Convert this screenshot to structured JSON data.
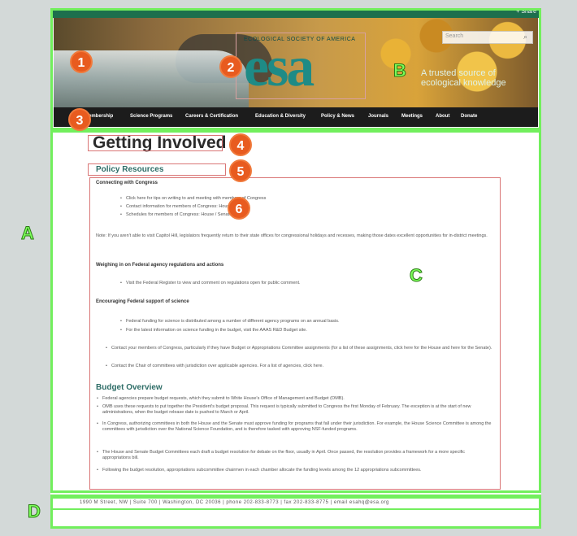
{
  "header": {
    "share_label": "+ Share",
    "search_placeholder": "Search",
    "logo_top_text": "ECOLOGICAL SOCIETY OF AMERICA",
    "logo_text": "esa",
    "tagline": "A trusted source of ecological knowledge"
  },
  "nav": {
    "items": [
      "...embership",
      "Science Programs",
      "Careers & Certification",
      "Education & Diversity",
      "Policy & News",
      "Journals",
      "Meetings",
      "About",
      "Donate"
    ]
  },
  "annotations": {
    "badges": [
      "1",
      "2",
      "3",
      "4",
      "5",
      "6"
    ],
    "letters": [
      "A",
      "B",
      "C",
      "D"
    ],
    "box_color": "#72ef5d",
    "badge_color": "#e85b1f"
  },
  "content": {
    "title": "Getting Involved",
    "policy_heading": "Policy Resources",
    "connecting_heading": "Connecting with Congress",
    "connecting_items": [
      "Click here for tips on writing to and meeting with members of Congress",
      "Contact information for members of Congress: House / Senate",
      "Schedules for members of Congress: House / Senate"
    ],
    "note_text": "Note: If you aren't able to visit Capitol Hill, legislators frequently return to their state offices for congressional holidays and recesses, making those dates excellent opportunities for in-district meetings.",
    "weighing_heading": "Weighing in on Federal agency regulations and actions",
    "weighing_item": "Visit the Federal Register to view and comment on regulations open for public comment.",
    "encouraging_heading": "Encouraging Federal support of science",
    "encouraging_items": [
      "Federal funding for science is distributed among a number of different agency programs on an annual basis.",
      "For the latest information on science funding in the budget, visit the AAAS R&D Budget site."
    ],
    "contact_items": [
      "Contact your members of Congress, particularly if they have Budget or Appropriations Committee assignments (for a list of these assignments, click here for the House and here for the Senate).",
      "Contact the Chair of committees with jurisdiction over applicable agencies. For a list of agencies, click here."
    ],
    "budget_heading": "Budget Overview",
    "budget_items": [
      "Federal agencies prepare budget requests, which they submit to White House's Office of Management and Budget (OMB).",
      "OMB uses these requests to put together the President's budget proposal. This request is typically submitted to Congress the first Monday of February. The exception is at the start of new administrations, when the budget release date is pushed to March or April.",
      "In Congress, authorizing committees in both the House and the Senate must approve funding for programs that fall under their jurisdiction. For example, the House Science Committee is among the committees with jurisdiction over the National Science Foundation, and is therefore tasked with approving NSF-funded programs.",
      "The House and Senate Budget Committees each draft a budget resolution for debate on the floor, usually in April. Once passed, the resolution provides a framework for a more specific appropriations bill.",
      "Following the budget resolution, appropriations subcommittee chairmen in each chamber allocate the funding levels among the 12 appropriations subcommittees."
    ]
  },
  "footer": {
    "address": "1990 M Street, NW | Suite 700 | Washington, DC 20036 | phone 202-833-8773 | fax 202-833-8775 | email esahq@esa.org"
  }
}
